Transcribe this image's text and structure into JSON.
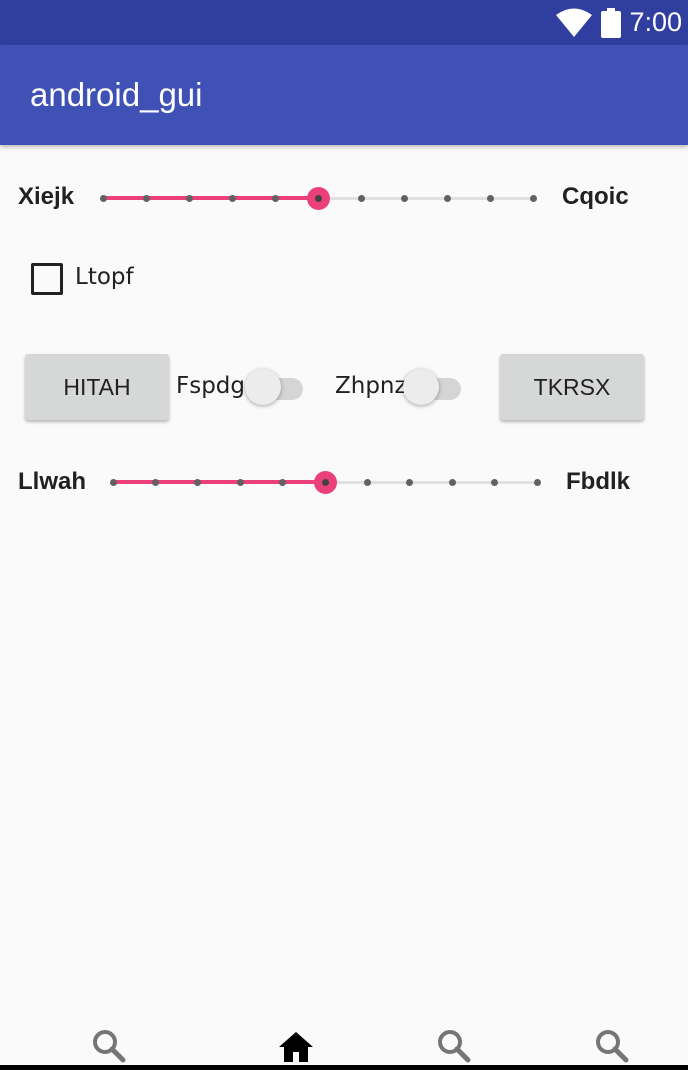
{
  "status_bar": {
    "time": "7:00",
    "icons": [
      "wifi-icon",
      "battery-icon"
    ],
    "color": "#303f9f"
  },
  "app_bar": {
    "title": "android_gui",
    "color": "#3f51b5"
  },
  "seekbar1": {
    "left_label": "Xiejk",
    "right_label": "Cqoic",
    "max": 10,
    "progress": 5
  },
  "checkbox": {
    "label": "Ltopf",
    "checked": false
  },
  "row": {
    "button_left": "HITAH",
    "switch1_label": "Fspdg",
    "switch1_on": false,
    "switch2_label": "Zhpnz",
    "switch2_on": false,
    "button_right": "TKRSX"
  },
  "seekbar2": {
    "left_label": "Llwah",
    "right_label": "Fbdlk",
    "max": 10,
    "progress": 5
  },
  "bottom_nav": {
    "items": [
      "search-icon",
      "home-icon",
      "search-icon",
      "search-icon"
    ],
    "active": 1
  },
  "accent_color": "#ec407a"
}
